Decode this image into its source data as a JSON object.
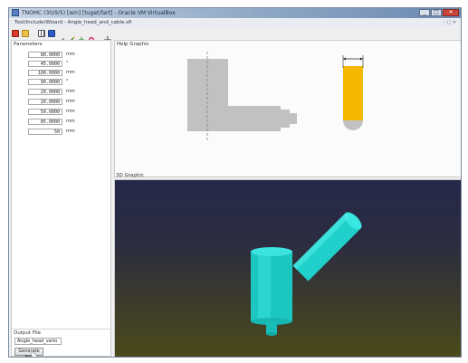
{
  "window": {
    "title": "TNOMC (30/9/5) [win] [tuget/fart] - Oracle VM VirtualBox",
    "buttons": [
      "_",
      "□",
      "✕"
    ]
  },
  "vbox_menu": {
    "left_text": "Tool/Include/Wizard - Angle_head_and_cable.sfl",
    "right_text": "- □ ✕"
  },
  "toolbar": {
    "icons": [
      "stop-icon",
      "open-folder-icon",
      "grid-icon",
      "blue-square-icon",
      "pencil-icon",
      "wand-icon",
      "node-icon",
      "target-icon",
      "crosshair-icon"
    ]
  },
  "parameters": {
    "label": "Parameters",
    "rows": [
      {
        "value": "80.0000",
        "unit": "mm"
      },
      {
        "value": "45.0000",
        "unit": "°"
      },
      {
        "value": "100.0000",
        "unit": "mm"
      },
      {
        "value": "90.0000",
        "unit": "°"
      },
      {
        "value": "20.0000",
        "unit": "mm"
      },
      {
        "value": "20.0000",
        "unit": "mm"
      },
      {
        "value": "50.0000",
        "unit": "mm"
      },
      {
        "value": "85.0000",
        "unit": "mm"
      },
      {
        "value": "50",
        "unit": "mm"
      }
    ]
  },
  "output": {
    "label": "Output File",
    "filename": "Angle_head_vario",
    "generate_button": "Generate File"
  },
  "help_graphic": {
    "label": "Help Graphic",
    "highlight_color": "#f5b800",
    "shape_color": "#c1c1c1"
  },
  "graphic_3d": {
    "label": "3D Graphic",
    "model_color": "#22d9d4"
  }
}
